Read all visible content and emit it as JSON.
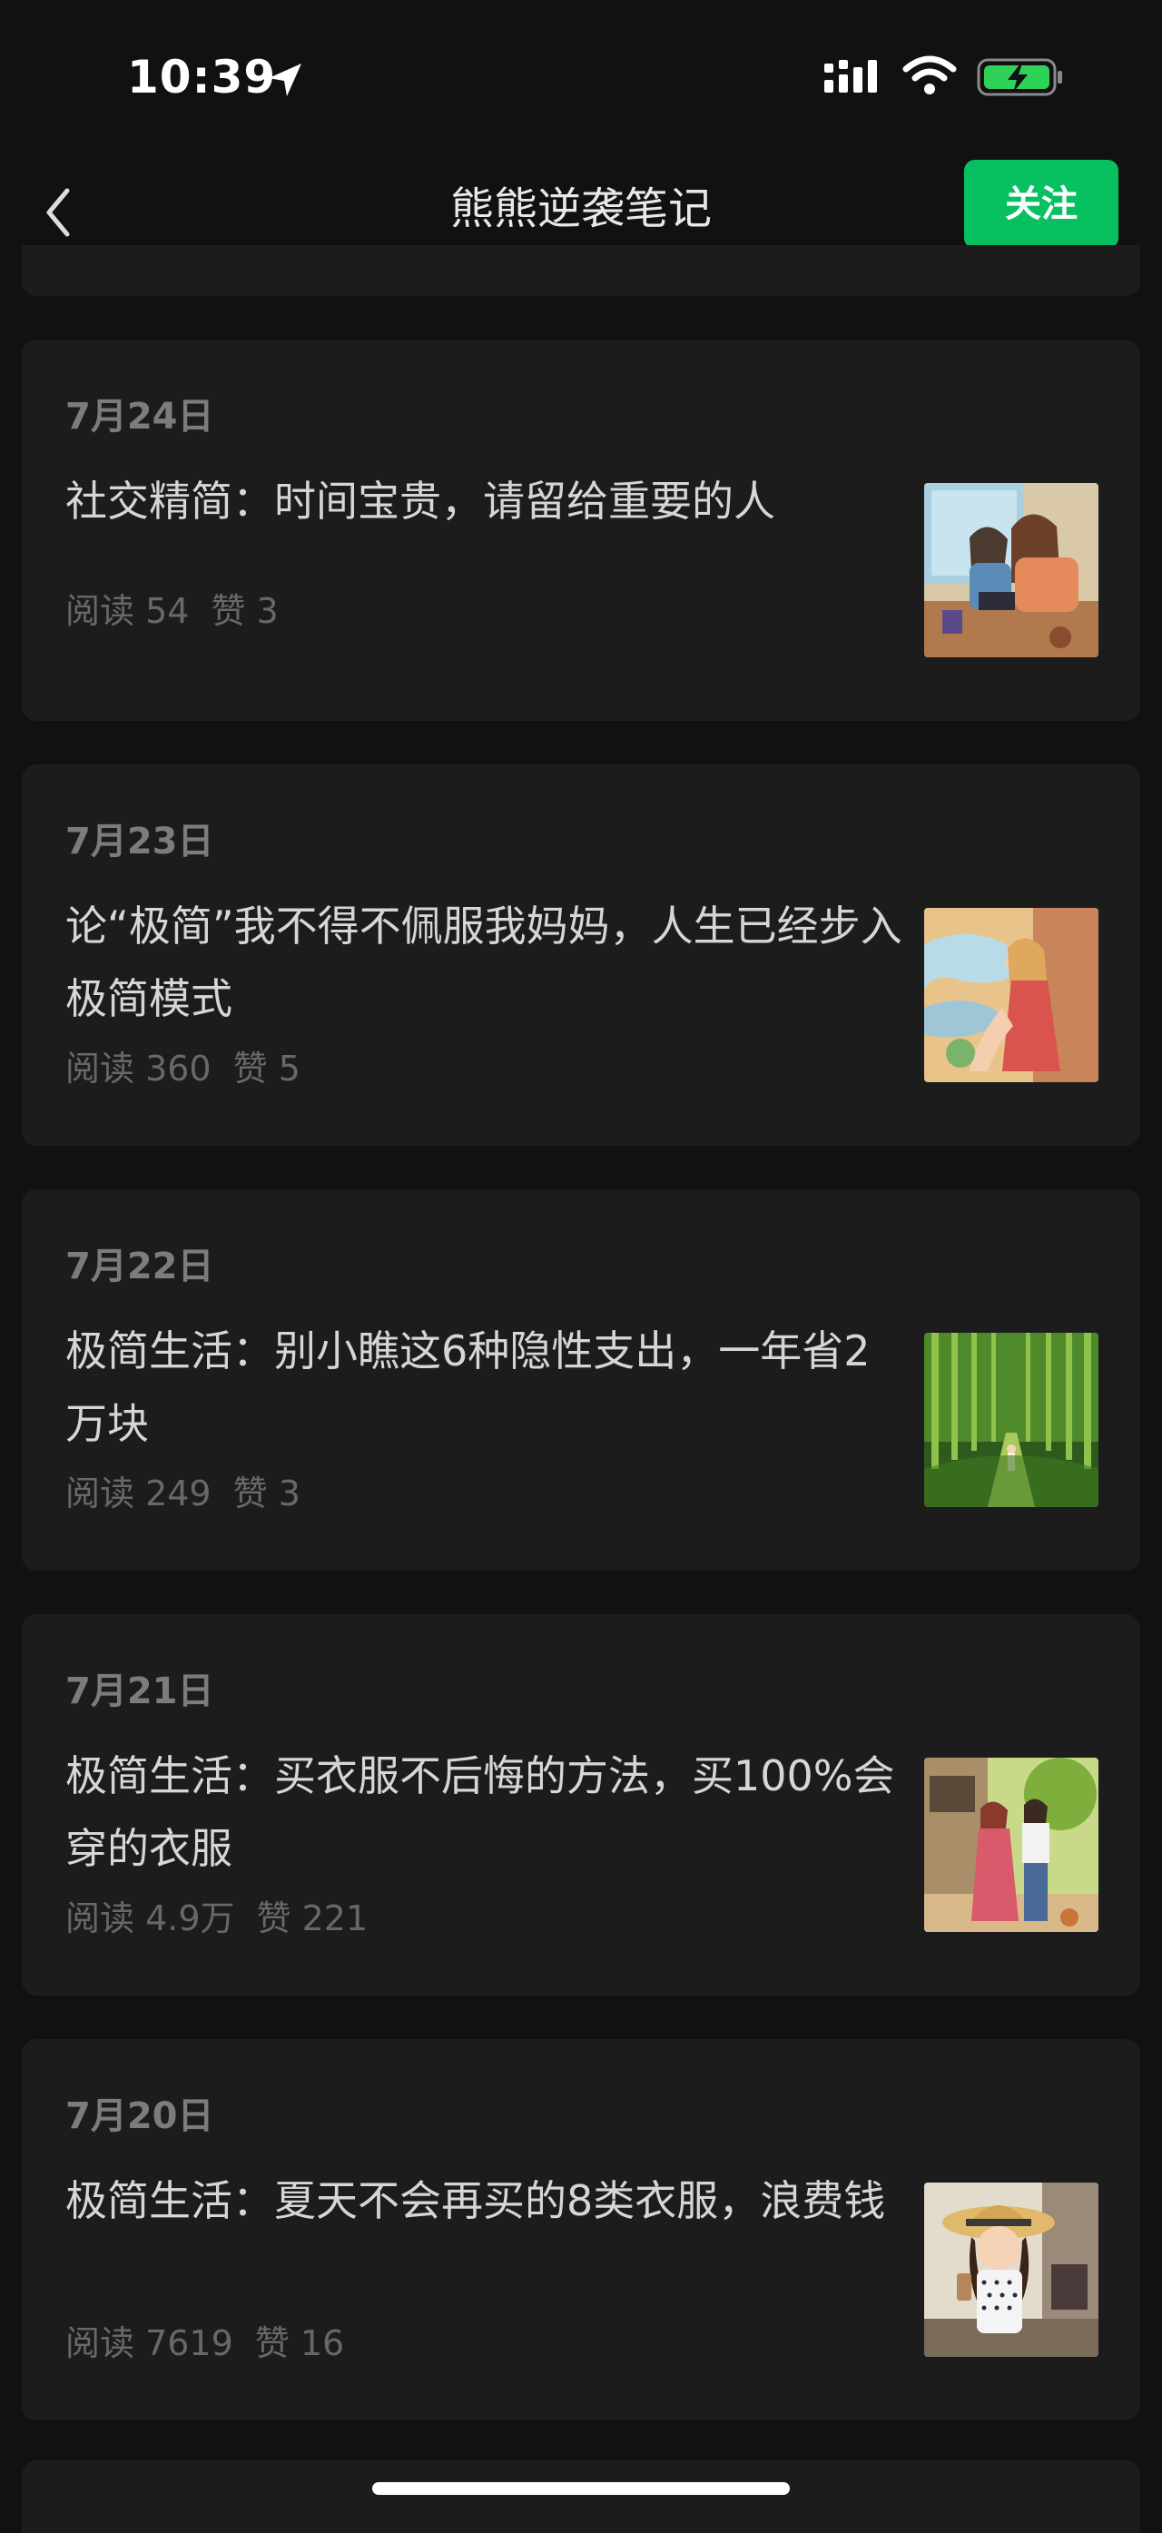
{
  "status_bar": {
    "time": "10:39",
    "location_icon": "location-arrow-icon",
    "signal_icon": "cellular-signal-icon",
    "wifi_icon": "wifi-icon",
    "battery_icon": "battery-charging-icon",
    "battery_color": "#30d158"
  },
  "nav": {
    "back_icon": "chevron-left-icon",
    "title": "熊熊逆袭笔记",
    "follow_label": "关注",
    "accent": "#07c160"
  },
  "articles": [
    {
      "date": "7月24日",
      "title": "社交精简：时间宝贵，请留给重要的人",
      "reads": "阅读 54",
      "likes": "赞 3",
      "thumbnail": "illustration-two-women-reading-by-window"
    },
    {
      "date": "7月23日",
      "title": "论“极简”我不得不佩服我妈妈，人生已经步入极简模式",
      "reads": "阅读 360",
      "likes": "赞 5",
      "thumbnail": "illustration-woman-with-flowing-scarf"
    },
    {
      "date": "7月22日",
      "title": "极简生活：别小瞧这6种隐性支出，一年省2万块",
      "reads": "阅读 249",
      "likes": "赞 3",
      "thumbnail": "illustration-woman-in-bamboo-forest"
    },
    {
      "date": "7月21日",
      "title": "极简生活：买衣服不后悔的方法，买100%会穿的衣服",
      "reads": "阅读 4.9万",
      "likes": "赞 221",
      "thumbnail": "illustration-two-women-on-street"
    },
    {
      "date": "7月20日",
      "title": "极简生活：夏天不会再买的8类衣服，浪费钱",
      "reads": "阅读 7619",
      "likes": "赞 16",
      "thumbnail": "illustration-girl-with-sun-hat-and-drink"
    }
  ]
}
